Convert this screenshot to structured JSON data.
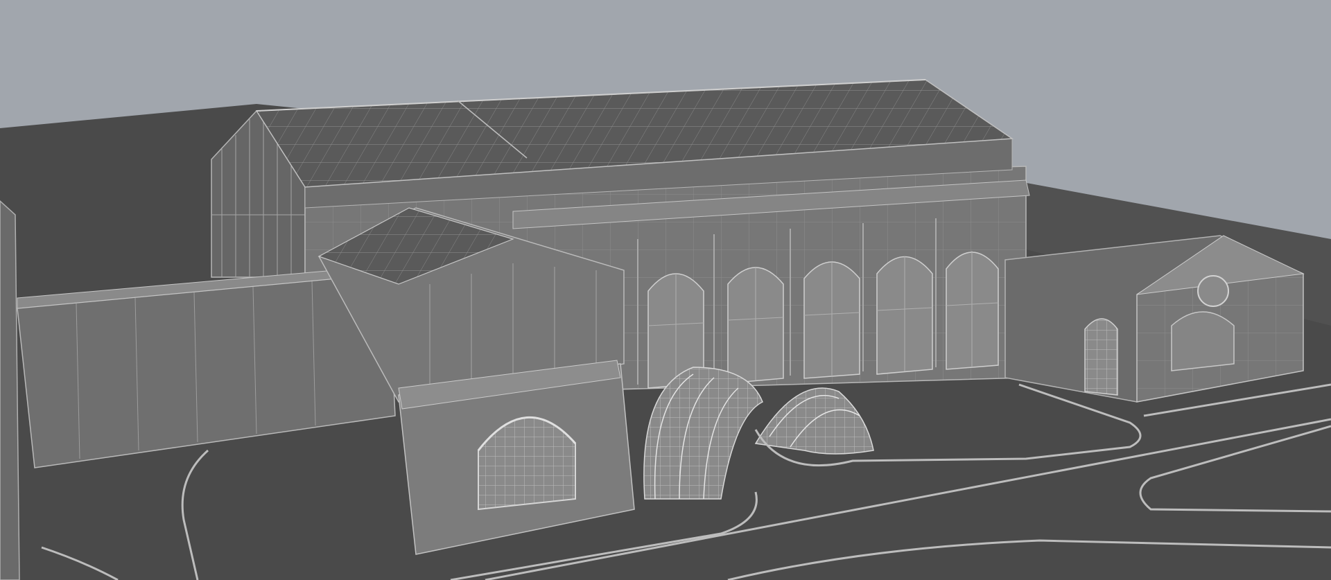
{
  "scene": {
    "colors": {
      "sky": "#a1a6ad",
      "ground": "#4a4a4a",
      "wall_light": "#7b7b7b",
      "wall_dark": "#5e5e5e",
      "glass_roof": "#5b5b5b",
      "line_light": "#c8c8c8",
      "line_dim": "#9a9a9a"
    },
    "icons": {
      "viewport": "3d-wireframe-render"
    }
  }
}
